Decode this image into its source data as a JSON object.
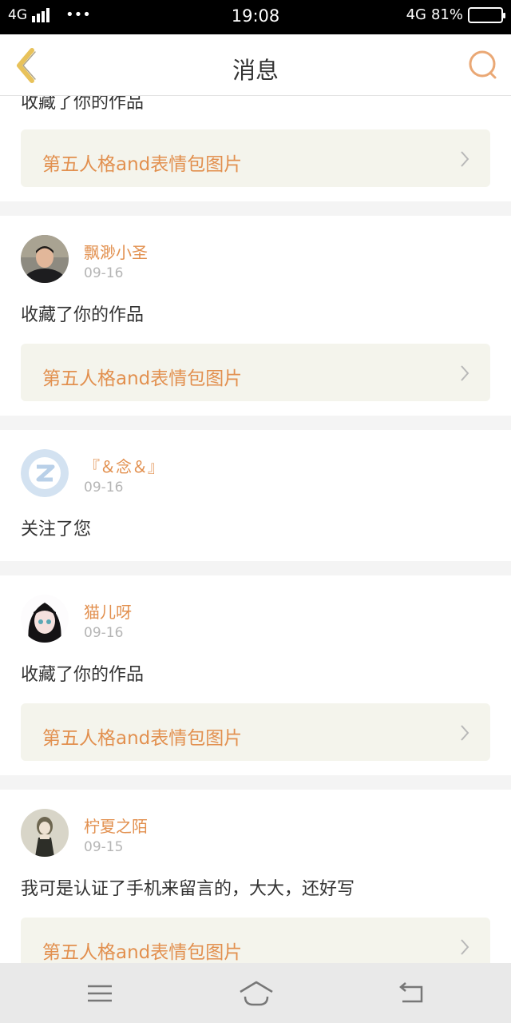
{
  "status_bar": {
    "network_left": "4G",
    "dots": "•••",
    "time": "19:08",
    "network_right": "4G",
    "battery": "81%",
    "battery_level": 0.81
  },
  "nav": {
    "title": "消息"
  },
  "colors": {
    "accent": "#e2904f",
    "back_icon": "#e8c25a",
    "page_bg": "#f4f4f4",
    "link_bg": "#f4f4ec"
  },
  "feed": {
    "top_partial": {
      "text": "收藏了你的作品",
      "work_title": "第五人格and表情包图片"
    },
    "items": [
      {
        "name": "飘渺小圣",
        "date": "09-16",
        "text": "收藏了你的作品",
        "work_title": "第五人格and表情包图片"
      },
      {
        "name": "『＆念＆』",
        "date": "09-16",
        "text": "关注了您"
      },
      {
        "name": "猫儿呀",
        "date": "09-16",
        "text": "收藏了你的作品",
        "work_title": "第五人格and表情包图片"
      },
      {
        "name": "柠夏之陌",
        "date": "09-15",
        "text": "我可是认证了手机来留言的，大大，还好写",
        "work_title": "第五人格and表情包图片"
      }
    ]
  },
  "icons": {
    "back": "chevron-left-icon",
    "search": "search-icon",
    "chevron": "chevron-right-icon",
    "menu": "menu-icon",
    "home": "home-icon",
    "return": "back-arrow-icon"
  }
}
